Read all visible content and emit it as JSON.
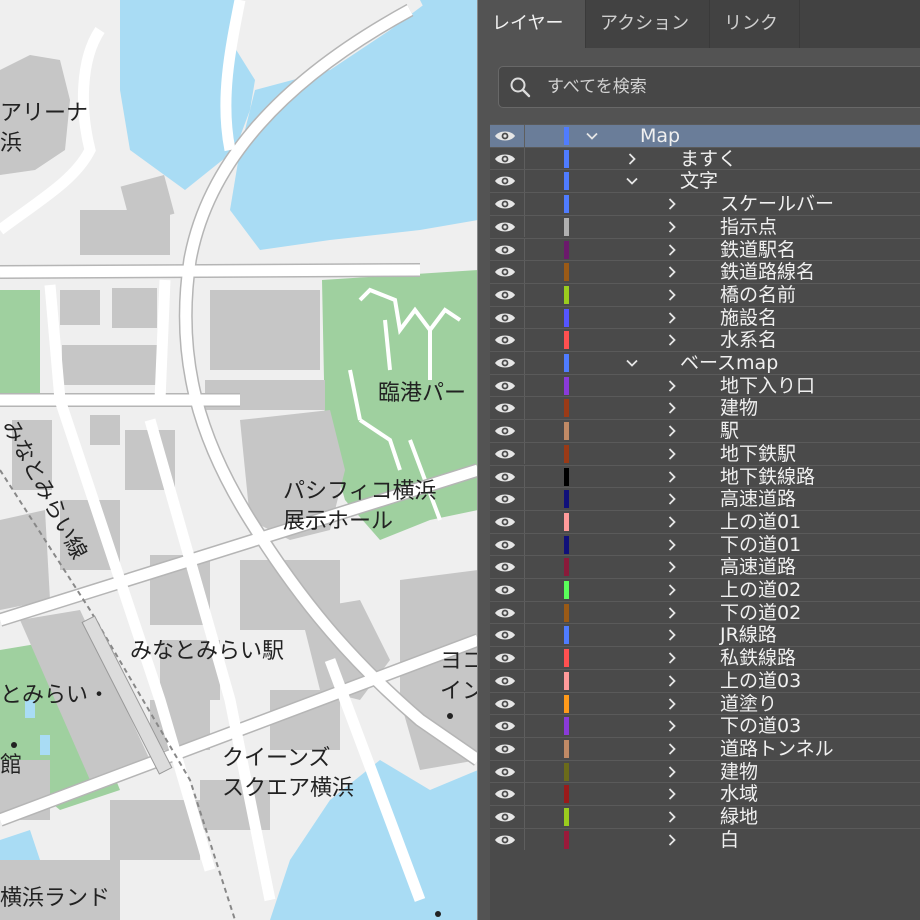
{
  "map": {
    "labels": {
      "arena": "アリーナ",
      "arena2": "浜",
      "rinko_park": "臨港パー",
      "line_name": "みなとみらい線",
      "pacifico1": "パシフィコ横浜",
      "pacifico2": "展示ホール",
      "mm_station": "みなとみらい駅",
      "mm_left": "とみらい・",
      "yoko": "ヨコ",
      "in": "イン",
      "queens1": "クイーンズ",
      "queens2": "スクエア横浜",
      "kan": "館",
      "landmark": "横浜ランド"
    },
    "colors": {
      "land": "#efefef",
      "water": "#a9dcf4",
      "park": "#9fd09f",
      "building": "#c6c6c6",
      "road": "#ffffff",
      "road_edge": "#b5b5b5"
    }
  },
  "panel": {
    "tabs": [
      {
        "label": "レイヤー",
        "active": true
      },
      {
        "label": "アクション",
        "active": false
      },
      {
        "label": "リンク",
        "active": false
      }
    ],
    "search": {
      "placeholder": "すべてを検索",
      "icon": "search-icon"
    },
    "layers": [
      {
        "name": "Map",
        "level": 0,
        "expanded": true,
        "color": "#4f7cff",
        "selected": true
      },
      {
        "name": "ますく",
        "level": 1,
        "expanded": false,
        "color": "#4f7cff"
      },
      {
        "name": "文字",
        "level": 1,
        "expanded": true,
        "color": "#4f7cff"
      },
      {
        "name": "スケールバー",
        "level": 2,
        "expanded": false,
        "color": "#4f7cff"
      },
      {
        "name": "指示点",
        "level": 2,
        "expanded": false,
        "color": "#b0b0b0"
      },
      {
        "name": "鉄道駅名",
        "level": 2,
        "expanded": false,
        "color": "#6b1a6b"
      },
      {
        "name": "鉄道路線名",
        "level": 2,
        "expanded": false,
        "color": "#9a5a16"
      },
      {
        "name": "橋の名前",
        "level": 2,
        "expanded": false,
        "color": "#9acd1e"
      },
      {
        "name": "施設名",
        "level": 2,
        "expanded": false,
        "color": "#5555ff"
      },
      {
        "name": "水系名",
        "level": 2,
        "expanded": false,
        "color": "#ff5050"
      },
      {
        "name": "ベースmap",
        "level": 1,
        "expanded": true,
        "color": "#4f7cff"
      },
      {
        "name": "地下入り口",
        "level": 2,
        "expanded": false,
        "color": "#8a3ad9"
      },
      {
        "name": "建物",
        "level": 2,
        "expanded": false,
        "color": "#9a3a16"
      },
      {
        "name": "駅",
        "level": 2,
        "expanded": false,
        "color": "#c08a66"
      },
      {
        "name": "地下鉄駅",
        "level": 2,
        "expanded": false,
        "color": "#9a3a16"
      },
      {
        "name": "地下鉄線路",
        "level": 2,
        "expanded": false,
        "color": "#000000"
      },
      {
        "name": "高速道路",
        "level": 2,
        "expanded": false,
        "color": "#10107a"
      },
      {
        "name": "上の道01",
        "level": 2,
        "expanded": false,
        "color": "#ff9a9a"
      },
      {
        "name": "下の道01",
        "level": 2,
        "expanded": false,
        "color": "#10107a"
      },
      {
        "name": "高速道路",
        "level": 2,
        "expanded": false,
        "color": "#8a1a3a"
      },
      {
        "name": "上の道02",
        "level": 2,
        "expanded": false,
        "color": "#5aff5a"
      },
      {
        "name": "下の道02",
        "level": 2,
        "expanded": false,
        "color": "#9a5a16"
      },
      {
        "name": "JR線路",
        "level": 2,
        "expanded": false,
        "color": "#4f7cff"
      },
      {
        "name": "私鉄線路",
        "level": 2,
        "expanded": false,
        "color": "#ff5050"
      },
      {
        "name": "上の道03",
        "level": 2,
        "expanded": false,
        "color": "#ff9a9a"
      },
      {
        "name": "道塗り",
        "level": 2,
        "expanded": false,
        "color": "#ff9a1a"
      },
      {
        "name": "下の道03",
        "level": 2,
        "expanded": false,
        "color": "#8a3ad9"
      },
      {
        "name": "道路トンネル",
        "level": 2,
        "expanded": false,
        "color": "#c08a66"
      },
      {
        "name": "建物",
        "level": 2,
        "expanded": false,
        "color": "#6b6b1a"
      },
      {
        "name": "水域",
        "level": 2,
        "expanded": false,
        "color": "#9a1a1a"
      },
      {
        "name": "緑地",
        "level": 2,
        "expanded": false,
        "color": "#9acd1e"
      },
      {
        "name": "白",
        "level": 2,
        "expanded": false,
        "color": "#9a1a3a"
      }
    ]
  }
}
